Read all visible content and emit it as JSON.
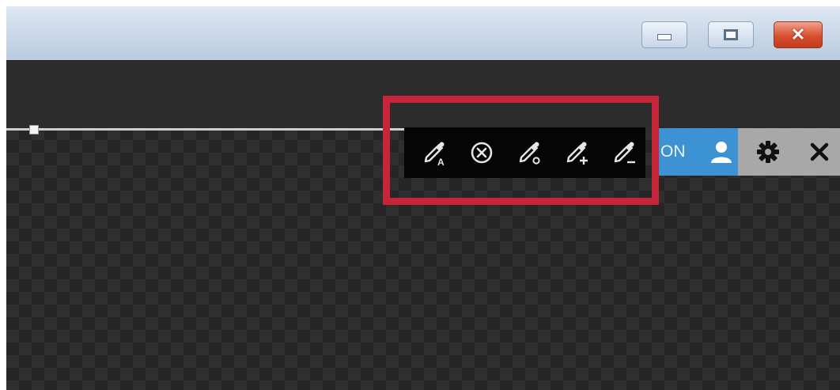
{
  "window": {
    "controls": {
      "minimize_icon": "minimize-icon",
      "maximize_icon": "maximize-icon",
      "close_label": "✕"
    }
  },
  "right_toolbar": {
    "on_label": "ON",
    "accent_color": "#3d92d4",
    "icons": [
      "user-icon",
      "gear-icon",
      "close-icon"
    ]
  },
  "color_toolbar": {
    "tools": [
      {
        "name": "auto-eyedropper-icon",
        "badge": "A"
      },
      {
        "name": "clear-circle-icon",
        "badge": ""
      },
      {
        "name": "eyedropper-sample-icon",
        "badge": "o"
      },
      {
        "name": "eyedropper-add-icon",
        "badge": "+"
      },
      {
        "name": "eyedropper-subtract-icon",
        "badge": "−"
      }
    ]
  },
  "highlight": {
    "color": "#c8243a"
  }
}
